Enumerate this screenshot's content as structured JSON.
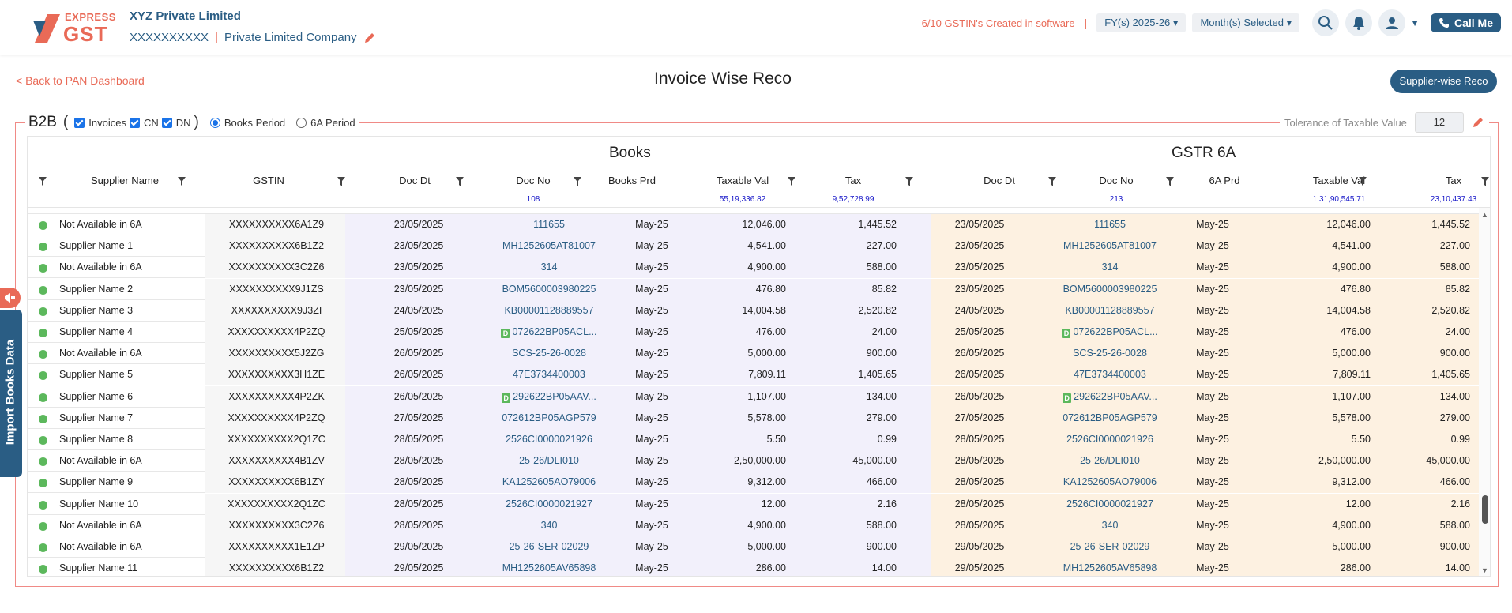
{
  "header": {
    "logo_top": "EXPRESS",
    "logo_bottom": "GST",
    "company_name": "XYZ Private Limited",
    "pan": "XXXXXXXXXX",
    "company_type": "Private Limited Company",
    "gstin_created": "6/10 GSTIN's Created in software",
    "fy": "FY(s) 2025-26",
    "months": "Month(s) Selected",
    "call_me": "Call Me"
  },
  "page": {
    "back_link": "< Back to PAN Dashboard",
    "title": "Invoice Wise Reco",
    "supplier_wise_button": "Supplier-wise Reco",
    "import_tab": "Import Books Data"
  },
  "filters": {
    "section": "B2B",
    "invoices": "Invoices",
    "cn": "CN",
    "dn": "DN",
    "books_period": "Books Period",
    "six_a_period": "6A Period",
    "tolerance_label": "Tolerance of Taxable Value",
    "tolerance_value": "12"
  },
  "table": {
    "group_books": "Books",
    "group_6a": "GSTR 6A",
    "columns": {
      "supplier": "Supplier Name",
      "gstin": "GSTIN",
      "b_docdt": "Doc Dt",
      "b_docno": "Doc No",
      "b_prd": "Books Prd",
      "b_taxable": "Taxable Val",
      "b_tax": "Tax",
      "a_docdt": "Doc Dt",
      "a_docno": "Doc No",
      "a_prd": "6A Prd",
      "a_taxable": "Taxable Val",
      "a_tax": "Tax"
    },
    "summaries": {
      "b_docno": "108",
      "b_taxable": "55,19,336.82",
      "b_tax": "9,52,728.99",
      "a_docno": "213",
      "a_taxable": "1,31,90,545.71",
      "a_tax": "23,10,437.43"
    },
    "rows": [
      {
        "supplier": "Not Available in 6A",
        "gstin": "XXXXXXXXXX6A1Z9",
        "b_docdt": "23/05/2025",
        "b_docno": "111655",
        "b_prd": "May-25",
        "b_taxable": "12,046.00",
        "b_tax": "1,445.52",
        "a_docdt": "23/05/2025",
        "a_docno": "111655",
        "a_prd": "May-25",
        "a_taxable": "12,046.00",
        "a_tax": "1,445.52",
        "doc_icon": false
      },
      {
        "supplier": "Supplier Name 1",
        "gstin": "XXXXXXXXXX6B1Z2",
        "b_docdt": "23/05/2025",
        "b_docno": "MH1252605AT81007",
        "b_prd": "May-25",
        "b_taxable": "4,541.00",
        "b_tax": "227.00",
        "a_docdt": "23/05/2025",
        "a_docno": "MH1252605AT81007",
        "a_prd": "May-25",
        "a_taxable": "4,541.00",
        "a_tax": "227.00",
        "doc_icon": false
      },
      {
        "supplier": "Not Available in 6A",
        "gstin": "XXXXXXXXXX3C2Z6",
        "b_docdt": "23/05/2025",
        "b_docno": "314",
        "b_prd": "May-25",
        "b_taxable": "4,900.00",
        "b_tax": "588.00",
        "a_docdt": "23/05/2025",
        "a_docno": "314",
        "a_prd": "May-25",
        "a_taxable": "4,900.00",
        "a_tax": "588.00",
        "doc_icon": false
      },
      {
        "supplier": "Supplier Name 2",
        "gstin": "XXXXXXXXXX9J1ZS",
        "b_docdt": "23/05/2025",
        "b_docno": "BOM5600003980225",
        "b_prd": "May-25",
        "b_taxable": "476.80",
        "b_tax": "85.82",
        "a_docdt": "23/05/2025",
        "a_docno": "BOM5600003980225",
        "a_prd": "May-25",
        "a_taxable": "476.80",
        "a_tax": "85.82",
        "doc_icon": false
      },
      {
        "supplier": "Supplier Name 3",
        "gstin": "XXXXXXXXXX9J3ZI",
        "b_docdt": "24/05/2025",
        "b_docno": "KB00001128889557",
        "b_prd": "May-25",
        "b_taxable": "14,004.58",
        "b_tax": "2,520.82",
        "a_docdt": "24/05/2025",
        "a_docno": "KB00001128889557",
        "a_prd": "May-25",
        "a_taxable": "14,004.58",
        "a_tax": "2,520.82",
        "doc_icon": false
      },
      {
        "supplier": "Supplier Name 4",
        "gstin": "XXXXXXXXXX4P2ZQ",
        "b_docdt": "25/05/2025",
        "b_docno": "072622BP05ACL...",
        "b_prd": "May-25",
        "b_taxable": "476.00",
        "b_tax": "24.00",
        "a_docdt": "25/05/2025",
        "a_docno": "072622BP05ACL...",
        "a_prd": "May-25",
        "a_taxable": "476.00",
        "a_tax": "24.00",
        "doc_icon": true
      },
      {
        "supplier": "Not Available in 6A",
        "gstin": "XXXXXXXXXX5J2ZG",
        "b_docdt": "26/05/2025",
        "b_docno": "SCS-25-26-0028",
        "b_prd": "May-25",
        "b_taxable": "5,000.00",
        "b_tax": "900.00",
        "a_docdt": "26/05/2025",
        "a_docno": "SCS-25-26-0028",
        "a_prd": "May-25",
        "a_taxable": "5,000.00",
        "a_tax": "900.00",
        "doc_icon": false
      },
      {
        "supplier": "Supplier Name 5",
        "gstin": "XXXXXXXXXX3H1ZE",
        "b_docdt": "26/05/2025",
        "b_docno": "47E3734400003",
        "b_prd": "May-25",
        "b_taxable": "7,809.11",
        "b_tax": "1,405.65",
        "a_docdt": "26/05/2025",
        "a_docno": "47E3734400003",
        "a_prd": "May-25",
        "a_taxable": "7,809.11",
        "a_tax": "1,405.65",
        "doc_icon": false
      },
      {
        "supplier": "Supplier Name 6",
        "gstin": "XXXXXXXXXX4P2ZK",
        "b_docdt": "26/05/2025",
        "b_docno": "292622BP05AAV...",
        "b_prd": "May-25",
        "b_taxable": "1,107.00",
        "b_tax": "134.00",
        "a_docdt": "26/05/2025",
        "a_docno": "292622BP05AAV...",
        "a_prd": "May-25",
        "a_taxable": "1,107.00",
        "a_tax": "134.00",
        "doc_icon": true
      },
      {
        "supplier": "Supplier Name 7",
        "gstin": "XXXXXXXXXX4P2ZQ",
        "b_docdt": "27/05/2025",
        "b_docno": "072612BP05AGP579",
        "b_prd": "May-25",
        "b_taxable": "5,578.00",
        "b_tax": "279.00",
        "a_docdt": "27/05/2025",
        "a_docno": "072612BP05AGP579",
        "a_prd": "May-25",
        "a_taxable": "5,578.00",
        "a_tax": "279.00",
        "doc_icon": false
      },
      {
        "supplier": "Supplier Name 8",
        "gstin": "XXXXXXXXXX2Q1ZC",
        "b_docdt": "28/05/2025",
        "b_docno": "2526CI0000021926",
        "b_prd": "May-25",
        "b_taxable": "5.50",
        "b_tax": "0.99",
        "a_docdt": "28/05/2025",
        "a_docno": "2526CI0000021926",
        "a_prd": "May-25",
        "a_taxable": "5.50",
        "a_tax": "0.99",
        "doc_icon": false
      },
      {
        "supplier": "Not Available in 6A",
        "gstin": "XXXXXXXXXX4B1ZV",
        "b_docdt": "28/05/2025",
        "b_docno": "25-26/DLI010",
        "b_prd": "May-25",
        "b_taxable": "2,50,000.00",
        "b_tax": "45,000.00",
        "a_docdt": "28/05/2025",
        "a_docno": "25-26/DLI010",
        "a_prd": "May-25",
        "a_taxable": "2,50,000.00",
        "a_tax": "45,000.00",
        "doc_icon": false
      },
      {
        "supplier": "Supplier Name 9",
        "gstin": "XXXXXXXXXX6B1ZY",
        "b_docdt": "28/05/2025",
        "b_docno": "KA1252605AO79006",
        "b_prd": "May-25",
        "b_taxable": "9,312.00",
        "b_tax": "466.00",
        "a_docdt": "28/05/2025",
        "a_docno": "KA1252605AO79006",
        "a_prd": "May-25",
        "a_taxable": "9,312.00",
        "a_tax": "466.00",
        "doc_icon": false
      },
      {
        "supplier": "Supplier Name 10",
        "gstin": "XXXXXXXXXX2Q1ZC",
        "b_docdt": "28/05/2025",
        "b_docno": "2526CI0000021927",
        "b_prd": "May-25",
        "b_taxable": "12.00",
        "b_tax": "2.16",
        "a_docdt": "28/05/2025",
        "a_docno": "2526CI0000021927",
        "a_prd": "May-25",
        "a_taxable": "12.00",
        "a_tax": "2.16",
        "doc_icon": false
      },
      {
        "supplier": "Not Available in 6A",
        "gstin": "XXXXXXXXXX3C2Z6",
        "b_docdt": "28/05/2025",
        "b_docno": "340",
        "b_prd": "May-25",
        "b_taxable": "4,900.00",
        "b_tax": "588.00",
        "a_docdt": "28/05/2025",
        "a_docno": "340",
        "a_prd": "May-25",
        "a_taxable": "4,900.00",
        "a_tax": "588.00",
        "doc_icon": false
      },
      {
        "supplier": "Not Available in 6A",
        "gstin": "XXXXXXXXXX1E1ZP",
        "b_docdt": "29/05/2025",
        "b_docno": "25-26-SER-02029",
        "b_prd": "May-25",
        "b_taxable": "5,000.00",
        "b_tax": "900.00",
        "a_docdt": "29/05/2025",
        "a_docno": "25-26-SER-02029",
        "a_prd": "May-25",
        "a_taxable": "5,000.00",
        "a_tax": "900.00",
        "doc_icon": false
      },
      {
        "supplier": "Supplier Name 11",
        "gstin": "XXXXXXXXXX6B1Z2",
        "b_docdt": "29/05/2025",
        "b_docno": "MH1252605AV65898",
        "b_prd": "May-25",
        "b_taxable": "286.00",
        "b_tax": "14.00",
        "a_docdt": "29/05/2025",
        "a_docno": "MH1252605AV65898",
        "a_prd": "May-25",
        "a_taxable": "286.00",
        "a_tax": "14.00",
        "doc_icon": false
      }
    ]
  },
  "colors": {
    "brand": "#e96a57",
    "primary": "#2a5d84",
    "status_green": "#5cb85c",
    "books_bg": "#f2f0fb",
    "gstr6a_bg": "#fdf1e1"
  },
  "icons": {
    "search": "search-icon",
    "bell": "bell-icon",
    "user": "user-icon",
    "phone": "phone-icon",
    "filter": "filter-icon",
    "edit": "pencil-icon",
    "doc": "document-icon"
  }
}
